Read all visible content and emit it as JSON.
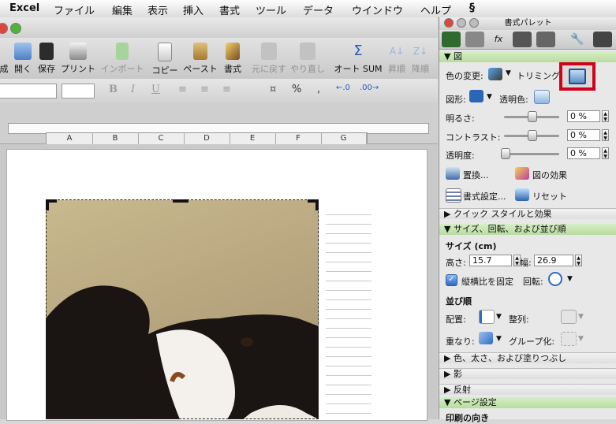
{
  "menubar": {
    "app": "Excel",
    "items": [
      "ファイル",
      "編集",
      "表示",
      "挿入",
      "書式",
      "ツール",
      "データ",
      "ウインドウ",
      "ヘルプ"
    ]
  },
  "toolbar": {
    "items": [
      {
        "label": "成"
      },
      {
        "label": "開く"
      },
      {
        "label": "保存"
      },
      {
        "label": "プリント"
      },
      {
        "label": "インポート",
        "disabled": true
      },
      {
        "label": "コピー"
      },
      {
        "label": "ペースト"
      },
      {
        "label": "書式"
      },
      {
        "label": "元に戻す",
        "disabled": true
      },
      {
        "label": "やり直し",
        "disabled": true
      },
      {
        "label": "オート SUM"
      },
      {
        "label": "昇順",
        "disabled": true
      },
      {
        "label": "降順",
        "disabled": true
      }
    ]
  },
  "formatbar": {
    "bold": "B",
    "italic": "I",
    "underline": "U",
    "percent": "%",
    "comma": ","
  },
  "sheet": {
    "columns": [
      "A",
      "B",
      "C",
      "D",
      "E",
      "F",
      "G"
    ]
  },
  "palette": {
    "title": "書式パレット",
    "section_picture": {
      "title": "図",
      "color_change_label": "色の変更:",
      "trim_label": "トリミング",
      "shape_label": "図形:",
      "transparent_label": "透明色:",
      "brightness_label": "明るさ:",
      "brightness_value": "0 %",
      "contrast_label": "コントラスト:",
      "contrast_value": "0 %",
      "transparency_label": "透明度:",
      "transparency_value": "0 %",
      "replace_label": "置換...",
      "effects_label": "図の効果",
      "format_label": "書式設定...",
      "reset_label": "リセット"
    },
    "section_quick_style": "クイック スタイルと効果",
    "section_size": {
      "title": "サイズ、回転、および並び順",
      "size_heading": "サイズ (cm)",
      "height_label": "高さ:",
      "height_value": "15.7",
      "width_label": "幅:",
      "width_value": "26.9",
      "lock_ratio_label": "縦横比を固定",
      "rotate_label": "回転:",
      "order_heading": "並び順",
      "arrange_label": "配置:",
      "align_label": "整列:",
      "stack_label": "重なり:",
      "group_label": "グループ化:"
    },
    "section_color_weight": "色、太さ、および塗りつぶし",
    "section_shadow": "影",
    "section_reflection": "反射",
    "section_page_setup": "ページ設定",
    "page_orientation": "印刷の向き"
  },
  "colors": {
    "highlight": "#d0021b",
    "section_green": "#b8dca0"
  }
}
